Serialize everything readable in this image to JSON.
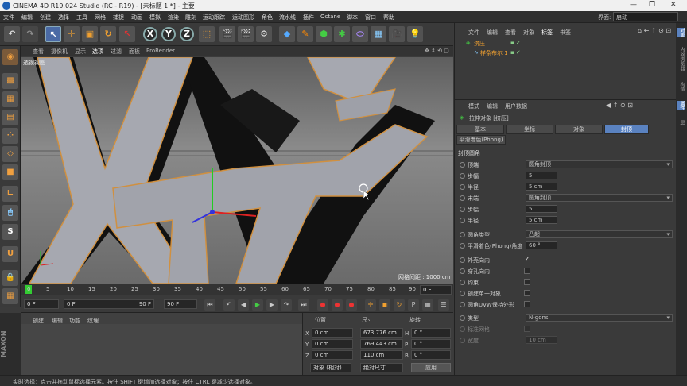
{
  "titlebar": {
    "title": "CINEMA 4D R19.024 Studio (RC - R19) - [未标题 1 *] - 主要",
    "min": "—",
    "max": "❐",
    "close": "✕"
  },
  "menu": [
    "文件",
    "编辑",
    "创建",
    "选择",
    "工具",
    "网格",
    "捕捉",
    "动画",
    "模拟",
    "渲染",
    "雕刻",
    "运动跟踪",
    "运动图形",
    "角色",
    "流水线",
    "插件",
    "Octane",
    "脚本",
    "窗口",
    "帮助"
  ],
  "layout": {
    "label": "界面:",
    "value": "启动"
  },
  "viewport": {
    "menu": [
      "查看",
      "摄像机",
      "显示",
      "选项",
      "过滤",
      "面板",
      "ProRender"
    ],
    "label": "透视视图",
    "grid_info": "网格间距 : 1000 cm"
  },
  "timeline": {
    "ticks": [
      "0",
      "5",
      "10",
      "15",
      "20",
      "25",
      "30",
      "35",
      "40",
      "45",
      "50",
      "55",
      "60",
      "65",
      "70",
      "75",
      "80",
      "85",
      "90"
    ],
    "end_value": "0 F"
  },
  "playback": {
    "current": "0 F",
    "start": "0 F",
    "end": "90 F",
    "max": "90 F"
  },
  "materials": {
    "menu": [
      "创建",
      "编辑",
      "功能",
      "纹理"
    ]
  },
  "coords": {
    "headers": [
      "位置",
      "尺寸",
      "旋转"
    ],
    "rows": [
      {
        "axis": "X",
        "pos": "0 cm",
        "size": "673.776 cm",
        "rot_axis": "H",
        "rot": "0 °"
      },
      {
        "axis": "Y",
        "pos": "0 cm",
        "size": "769.443 cm",
        "rot_axis": "P",
        "rot": "0 °"
      },
      {
        "axis": "Z",
        "pos": "0 cm",
        "size": "110 cm",
        "rot_axis": "B",
        "rot": "0 °"
      }
    ],
    "mode1": "对象 (相对)",
    "mode2": "绝对尺寸",
    "apply": "应用"
  },
  "objects": {
    "menu": [
      "文件",
      "编辑",
      "查看",
      "对象",
      "标签",
      "书签"
    ],
    "items": [
      "挤压",
      "样条布尔 1"
    ]
  },
  "attributes": {
    "menu": [
      "模式",
      "编辑",
      "用户数据"
    ],
    "object_title": "拉伸对象 [挤压]",
    "tabs": [
      "基本",
      "坐标",
      "对象",
      "封顶"
    ],
    "active_tab": "封顶",
    "subtab": "平滑着色(Phong)",
    "section": "封顶圆角",
    "rows": [
      {
        "label": "顶端",
        "type": "dd",
        "value": "圆角封顶"
      },
      {
        "label": "步幅",
        "type": "num",
        "value": "5"
      },
      {
        "label": "半径",
        "type": "num",
        "value": "5 cm"
      },
      {
        "label": "末端",
        "type": "dd",
        "value": "圆角封顶"
      },
      {
        "label": "步幅",
        "type": "num",
        "value": "5"
      },
      {
        "label": "半径",
        "type": "num",
        "value": "5 cm"
      },
      {
        "label": "圆角类型",
        "type": "dd",
        "value": "凸起"
      },
      {
        "label": "平滑着色(Phong)角度",
        "type": "num",
        "value": "60 °"
      },
      {
        "label": "外壳向内",
        "type": "chk",
        "value": "✓"
      },
      {
        "label": "穿孔向内",
        "type": "chk",
        "value": ""
      },
      {
        "label": "约束",
        "type": "chk",
        "value": ""
      },
      {
        "label": "创建单一对象",
        "type": "chk",
        "value": ""
      },
      {
        "label": "圆角UVW保持外形",
        "type": "chk",
        "value": ""
      },
      {
        "label": "类型",
        "type": "dd",
        "value": "N-gons"
      },
      {
        "label": "标准网格",
        "type": "chk",
        "value": ""
      },
      {
        "label": "宽度",
        "type": "num",
        "value": "10 cm"
      }
    ]
  },
  "sidetabs": [
    "对象",
    "内容浏览器",
    "构造",
    "属性",
    "层"
  ],
  "status": "实时选择：点击并拖动鼠标选择元素。按住 SHIFT 键增加选择对象；按住 CTRL 键减少选择对象。"
}
